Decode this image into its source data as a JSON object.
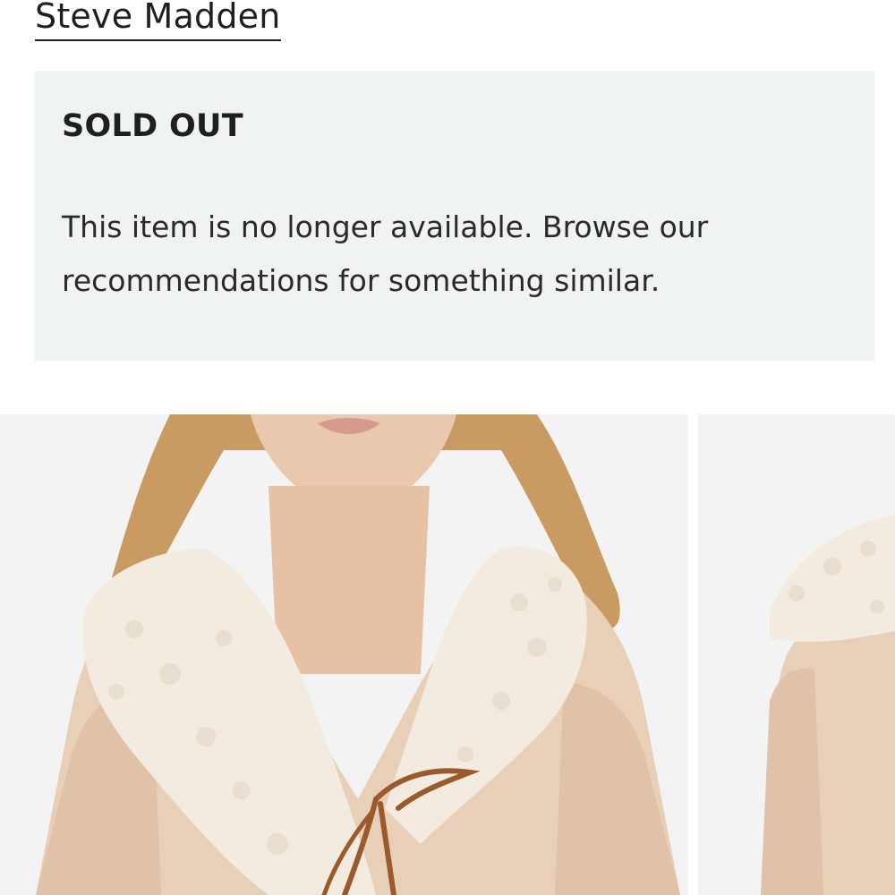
{
  "brand": {
    "name": "Steve Madden"
  },
  "notice": {
    "title": "SOLD OUT",
    "message": "This item is no longer available. Browse our recommendations for something similar."
  },
  "gallery": {
    "images": [
      {
        "subject": "model wearing beige faux fur shearling coat with tie front"
      },
      {
        "subject": "beige faux fur coat alternate view"
      }
    ]
  },
  "colors": {
    "panel_background": "#f0f3f4",
    "text": "#1f1f1f",
    "coat": "#e8cfb8",
    "fur": "#f3ebe0",
    "tie": "#9a5a2c"
  }
}
